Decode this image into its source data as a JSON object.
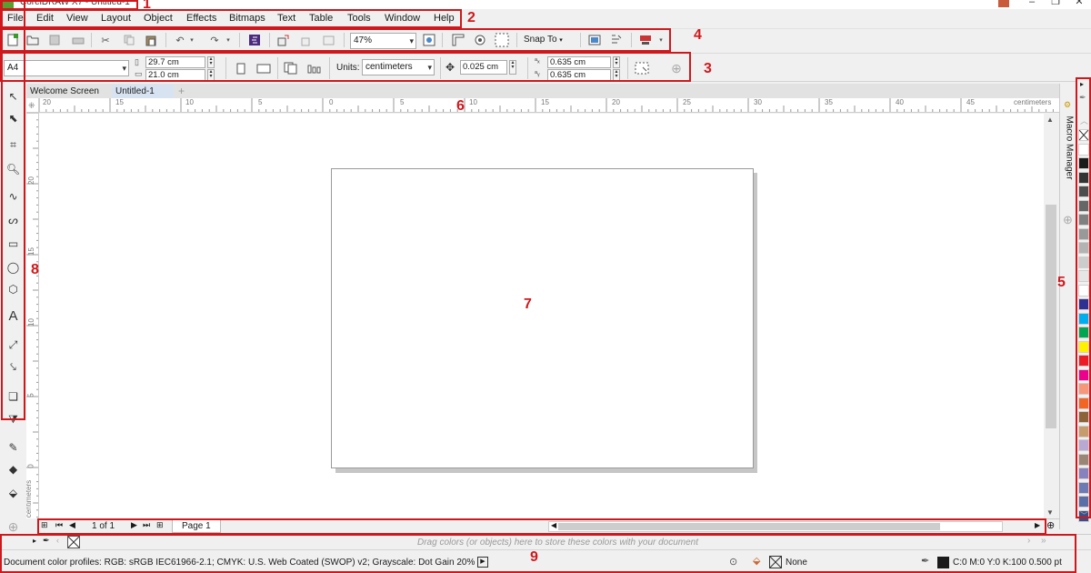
{
  "window": {
    "title": "CorelDRAW X7 - Untitled-1"
  },
  "menu": [
    "File",
    "Edit",
    "View",
    "Layout",
    "Object",
    "Effects",
    "Bitmaps",
    "Text",
    "Table",
    "Tools",
    "Window",
    "Help"
  ],
  "toolbar": {
    "zoom": "47%",
    "snap_to": "Snap To"
  },
  "property_bar": {
    "paper_size": "A4",
    "width": "29.7 cm",
    "height": "21.0 cm",
    "units_label": "Units:",
    "units_value": "centimeters",
    "nudge": "0.025 cm",
    "dup_x": "0.635 cm",
    "dup_y": "0.635 cm"
  },
  "doc_tabs": [
    "Welcome Screen",
    "Untitled-1"
  ],
  "ruler": {
    "units": "centimeters",
    "h_labels": [
      "20",
      "15",
      "10",
      "5",
      "0",
      "5",
      "10",
      "15",
      "20",
      "25",
      "30",
      "35",
      "40",
      "45"
    ],
    "v_labels": [
      "20",
      "15",
      "10",
      "5",
      "0"
    ],
    "v_unit": "centimeters"
  },
  "navigator": {
    "page_count": "1 of 1",
    "page_tab": "Page 1"
  },
  "docker": {
    "macro_manager": "Macro Manager"
  },
  "palette_colors": [
    "#ffffff",
    "#1a1a1a",
    "#333333",
    "#4d4d4d",
    "#666666",
    "#808080",
    "#999999",
    "#b3b3b3",
    "#cccccc",
    "#e6e6e6",
    "#ffffff",
    "#2e3192",
    "#00aeef",
    "#00a651",
    "#fff200",
    "#ed1c24",
    "#ec008c",
    "#f7977a",
    "#f26522",
    "#8c6239",
    "#c69c6d",
    "#b7a9d1",
    "#998675",
    "#8781bd",
    "#6d7bb5",
    "#5a6ea8",
    "#3a4f8a"
  ],
  "doc_palette_hint": "Drag colors (or objects) here to store these colors with your document",
  "status": {
    "color_profiles": "Document color profiles: RGB: sRGB IEC61966-2.1; CMYK: U.S. Web Coated (SWOP) v2; Grayscale: Dot Gain 20%",
    "fill": "None",
    "outline": "C:0 M:0 Y:0 K:100  0.500 pt"
  },
  "annotations": [
    "1",
    "2",
    "3",
    "4",
    "5",
    "6",
    "7",
    "8",
    "9"
  ],
  "colors": {
    "annotation": "#d0181c",
    "canvas": "#ffffff",
    "chrome": "#f0f0f0"
  }
}
